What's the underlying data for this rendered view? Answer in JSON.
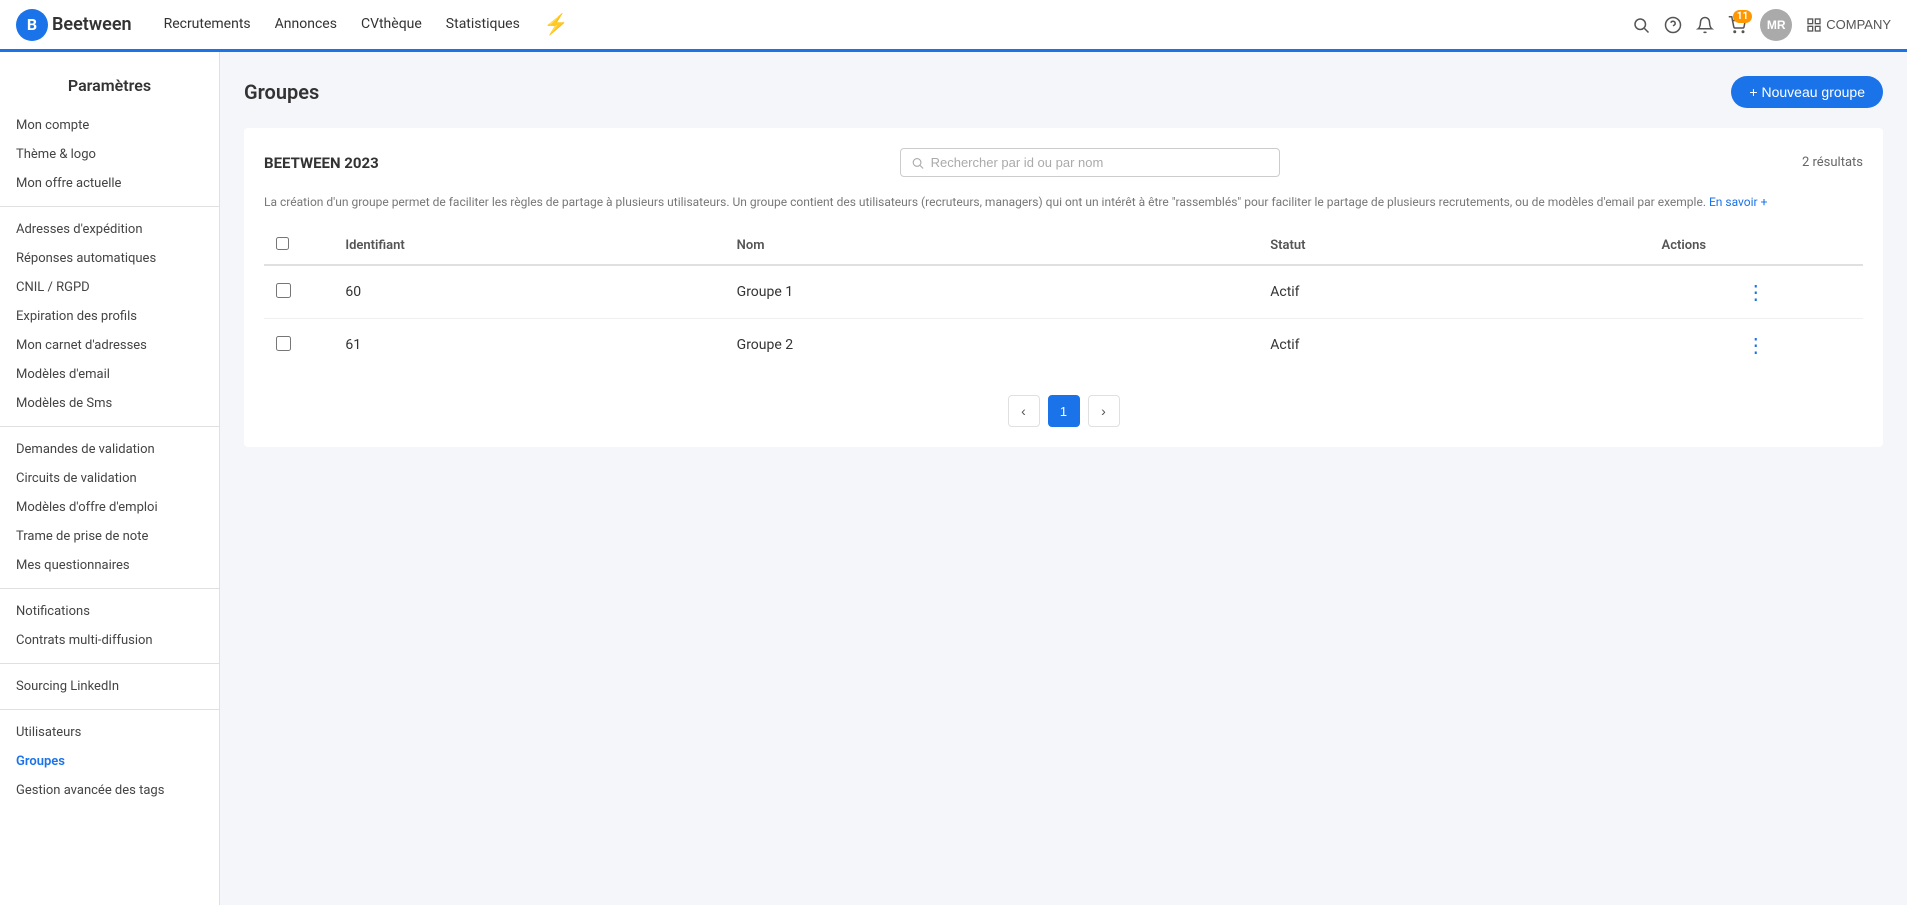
{
  "topnav": {
    "logo_letter": "B",
    "logo_text": "Beetween",
    "links": [
      {
        "label": "Recrutements",
        "id": "recrutements"
      },
      {
        "label": "Annonces",
        "id": "annonces"
      },
      {
        "label": "CVthèque",
        "id": "cvtheque"
      },
      {
        "label": "Statistiques",
        "id": "statistiques"
      }
    ],
    "notif_count": "11",
    "avatar_label": "MR",
    "company_label": "COMPANY"
  },
  "sidebar": {
    "title": "Paramètres",
    "items": [
      {
        "label": "Mon compte",
        "id": "mon-compte",
        "active": false
      },
      {
        "label": "Thème & logo",
        "id": "theme-logo",
        "active": false
      },
      {
        "label": "Mon offre actuelle",
        "id": "mon-offre",
        "active": false
      },
      {
        "label": "Adresses d'expédition",
        "id": "adresses",
        "active": false
      },
      {
        "label": "Réponses automatiques",
        "id": "reponses",
        "active": false
      },
      {
        "label": "CNIL / RGPD",
        "id": "cnil",
        "active": false
      },
      {
        "label": "Expiration des profils",
        "id": "expiration",
        "active": false
      },
      {
        "label": "Mon carnet d'adresses",
        "id": "carnet",
        "active": false
      },
      {
        "label": "Modèles d'email",
        "id": "modeles-email",
        "active": false
      },
      {
        "label": "Modèles de Sms",
        "id": "modeles-sms",
        "active": false
      },
      {
        "label": "Demandes de validation",
        "id": "demandes",
        "active": false
      },
      {
        "label": "Circuits de validation",
        "id": "circuits",
        "active": false,
        "has_dot": true
      },
      {
        "label": "Modèles d'offre d'emploi",
        "id": "modeles-offre",
        "active": false
      },
      {
        "label": "Trame de prise de note",
        "id": "trame",
        "active": false
      },
      {
        "label": "Mes questionnaires",
        "id": "questionnaires",
        "active": false
      },
      {
        "label": "Notifications",
        "id": "notifications",
        "active": false
      },
      {
        "label": "Contrats multi-diffusion",
        "id": "contrats",
        "active": false
      },
      {
        "label": "Sourcing LinkedIn",
        "id": "linkedin",
        "active": false
      },
      {
        "label": "Utilisateurs",
        "id": "utilisateurs",
        "active": false
      },
      {
        "label": "Groupes",
        "id": "groupes",
        "active": true
      },
      {
        "label": "Gestion avancée des tags",
        "id": "tags",
        "active": false
      }
    ]
  },
  "main": {
    "page_title": "Groupes",
    "new_btn_label": "+ Nouveau groupe",
    "section_title": "BEETWEEN 2023",
    "search_placeholder": "Rechercher par id ou par nom",
    "results_count": "2 résultats",
    "description": "La création d'un groupe permet de faciliter les règles de partage à plusieurs utilisateurs. Un groupe contient des utilisateurs (recruteurs, managers) qui ont un intérêt à être \"rassemblés\" pour faciliter le partage de plusieurs recrutements, ou de modèles d'email par exemple.",
    "learn_more_label": "En savoir +",
    "table": {
      "headers": [
        "Identifiant",
        "Nom",
        "Statut",
        "Actions"
      ],
      "rows": [
        {
          "id": "60",
          "name": "Groupe 1",
          "status": "Actif"
        },
        {
          "id": "61",
          "name": "Groupe 2",
          "status": "Actif"
        }
      ]
    },
    "pagination": {
      "current_page": "1",
      "prev_label": "‹",
      "next_label": "›"
    }
  }
}
